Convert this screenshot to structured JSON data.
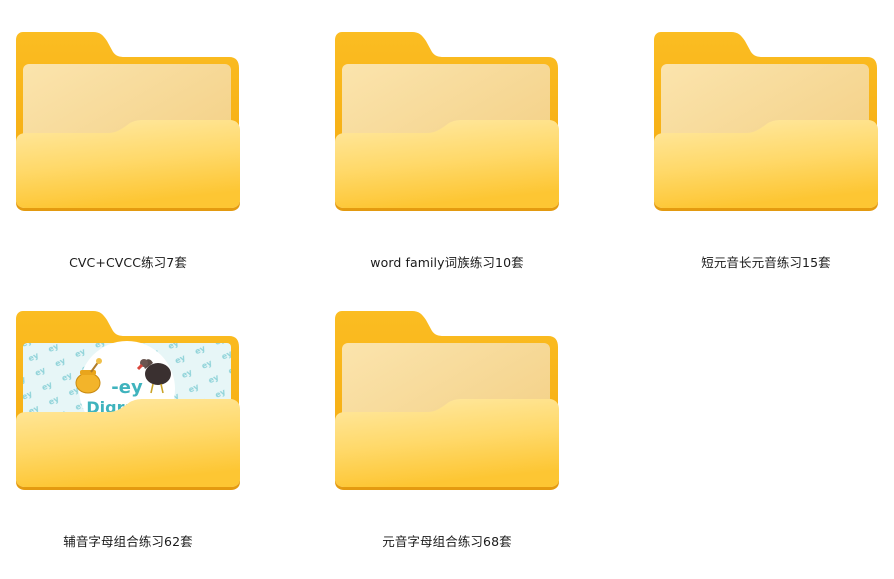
{
  "colors": {
    "folder_back": "#f8b91c",
    "folder_front_top": "#ffe79a",
    "folder_front_bottom": "#fdc93b",
    "paper_light": "#fbe3a9",
    "paper_dark": "#f3cf83",
    "thumb_teal": "#3fb3bd"
  },
  "folders": [
    {
      "name": "CVC+CVCC练习7套",
      "icon": "folder-icon"
    },
    {
      "name": "word family词族练习10套",
      "icon": "folder-icon"
    },
    {
      "name": "短元音长元音练习15套",
      "icon": "folder-icon"
    },
    {
      "name": "辅音字母组合练习62套",
      "icon": "folder-with-preview-icon",
      "preview": {
        "line1": "-ey",
        "line2": "Digraphs"
      }
    },
    {
      "name": "元音字母组合练习68套",
      "icon": "folder-icon"
    }
  ]
}
